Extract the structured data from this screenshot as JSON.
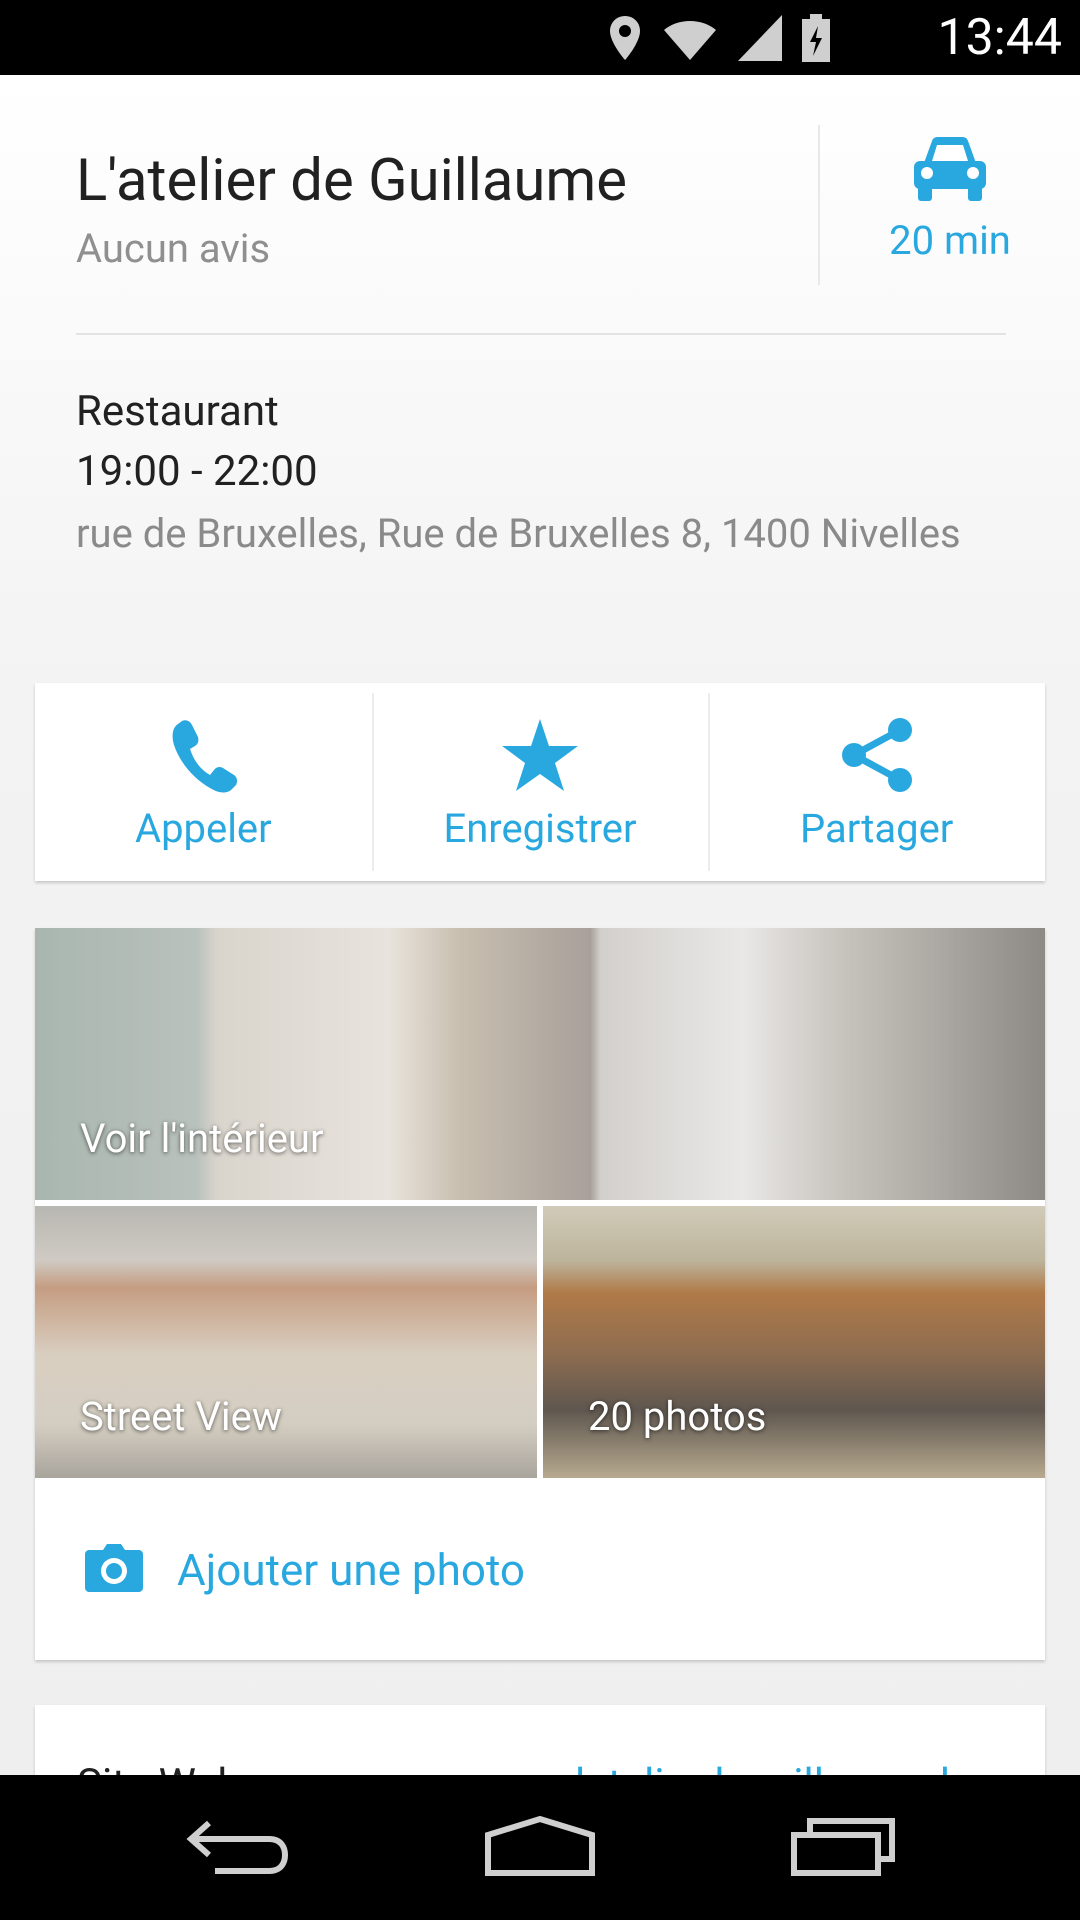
{
  "status_bar": {
    "time": "13:44",
    "icons": [
      "location-icon",
      "wifi-icon",
      "signal-icon",
      "battery-icon"
    ]
  },
  "place": {
    "name": "L'atelier de Guillaume",
    "reviews": "Aucun avis",
    "travel_time": "20 min",
    "category": "Restaurant",
    "hours": "19:00 - 22:00",
    "address": "rue de Bruxelles, Rue de Bruxelles 8, 1400 Nivelles"
  },
  "actions": [
    {
      "label": "Appeler",
      "icon": "phone-icon"
    },
    {
      "label": "Enregistrer",
      "icon": "star-icon"
    },
    {
      "label": "Partager",
      "icon": "share-icon"
    }
  ],
  "media": {
    "interior_label": "Voir l'intérieur",
    "street_view_label": "Street View",
    "photos_label": "20 photos",
    "add_photo_label": "Ajouter une photo"
  },
  "website_card": {
    "label": "Site Web",
    "value": "latelierdeguillaume.be"
  },
  "colors": {
    "accent": "#29a8e0",
    "title": "#212121",
    "secondary": "#8a8a8a"
  }
}
